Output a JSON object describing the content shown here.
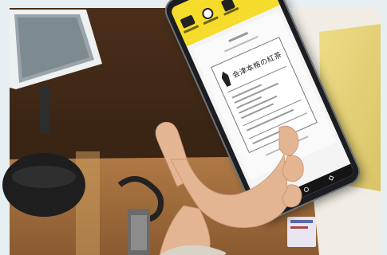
{
  "photo": {
    "subject": "",
    "background_tone": "#5a3b22"
  },
  "app_screen": {
    "accent_color": "#f6dc2a",
    "header": {
      "items": [
        {
          "label": "",
          "icon": "document-icon"
        },
        {
          "label": "",
          "icon": "coin-icon"
        },
        {
          "label": "",
          "icon": "bag-icon"
        }
      ],
      "right_text": ""
    },
    "receipt": {
      "shop_name": "会津本格の紅茶",
      "logo_icon": "bottle-logo-icon"
    },
    "nav_icons": [
      "back-icon",
      "home-icon",
      "recent-icon"
    ]
  }
}
